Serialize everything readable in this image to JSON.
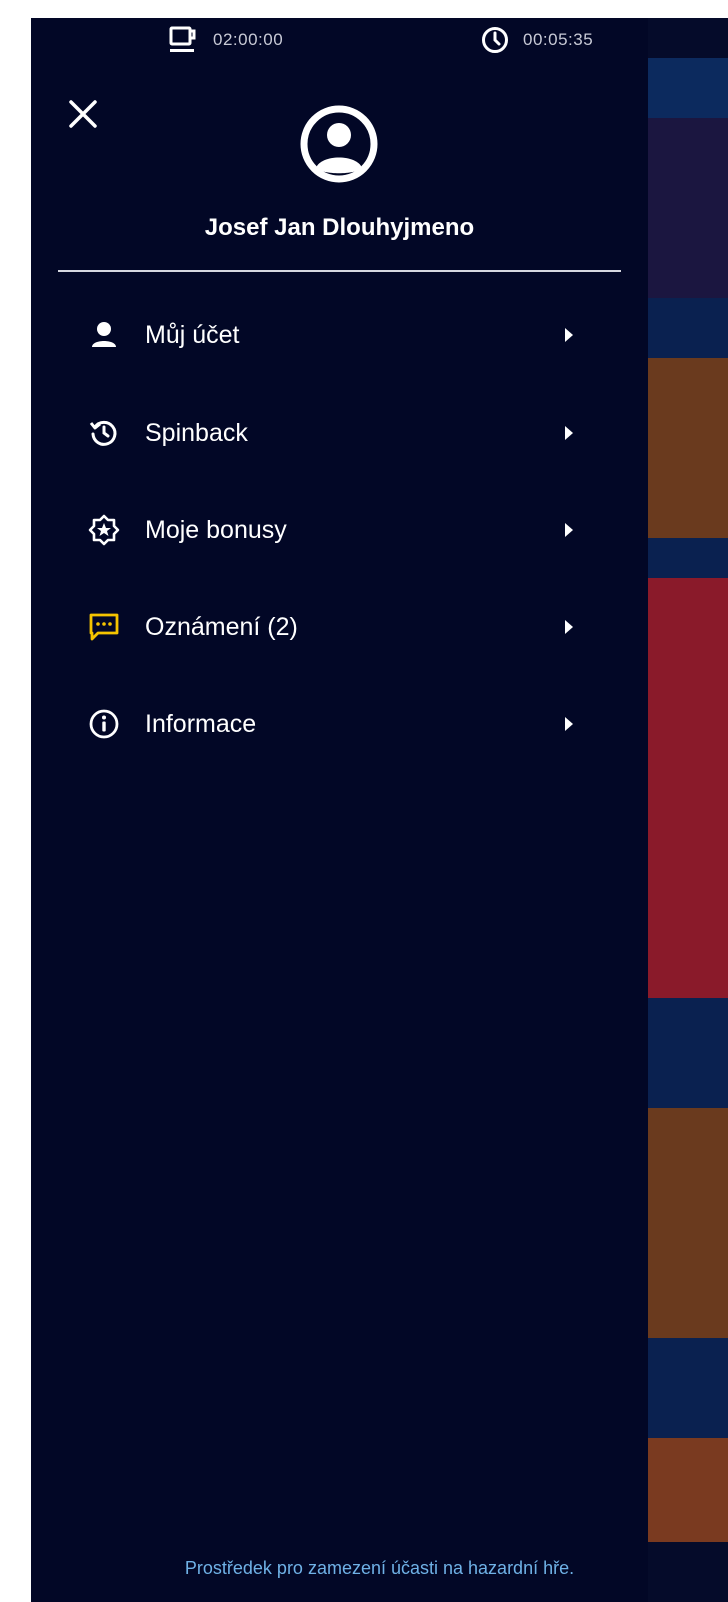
{
  "status_bar": {
    "break_time": "02:00:00",
    "session_time": "00:05:35"
  },
  "user": {
    "name": "Josef Jan Dlouhyjmeno"
  },
  "menu": {
    "items": [
      {
        "label": "Můj účet",
        "icon": "person-icon"
      },
      {
        "label": "Spinback",
        "icon": "history-icon"
      },
      {
        "label": "Moje bonusy",
        "icon": "star-badge-icon"
      },
      {
        "label": "Oznámení (2)",
        "icon": "message-icon"
      },
      {
        "label": "Informace",
        "icon": "info-icon"
      }
    ]
  },
  "footer": {
    "text": "Prostředek pro zamezení účasti na hazardní hře."
  },
  "colors": {
    "background": "#020726",
    "accent_yellow": "#f5c400",
    "footer_link": "#6fb1e6"
  }
}
